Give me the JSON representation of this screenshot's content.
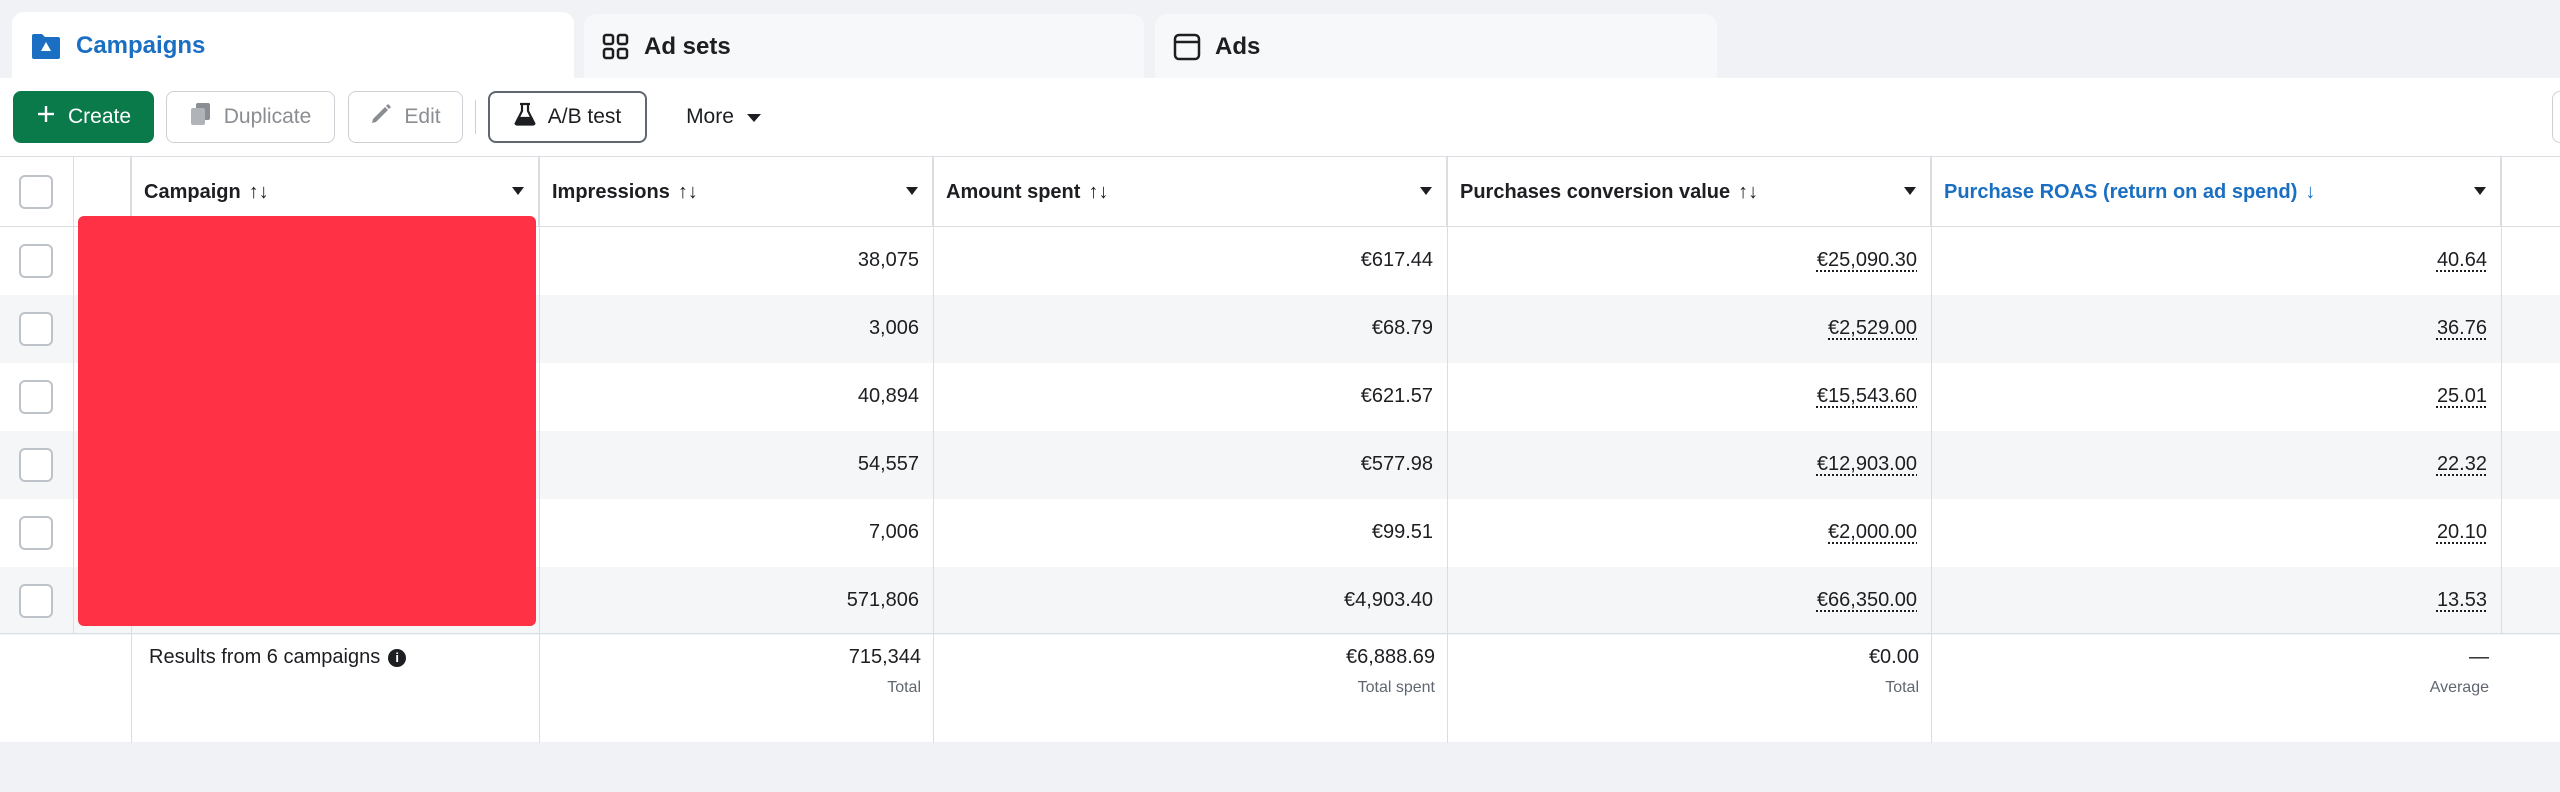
{
  "tabs": [
    {
      "label": "Campaigns",
      "icon": "folder-icon",
      "active": true
    },
    {
      "label": "Ad sets",
      "icon": "grid-icon",
      "active": false
    },
    {
      "label": "Ads",
      "icon": "window-icon",
      "active": false
    }
  ],
  "toolbar": {
    "create_label": "Create",
    "duplicate_label": "Duplicate",
    "edit_label": "Edit",
    "ab_label": "A/B test",
    "more_label": "More"
  },
  "columns": {
    "campaign": "Campaign",
    "impressions": "Impressions",
    "amount_spent": "Amount spent",
    "conv_value": "Purchases conversion value",
    "roas": "Purchase ROAS (return on ad spend)"
  },
  "rows": [
    {
      "impressions": "38,075",
      "amount_spent": "€617.44",
      "conv_value": "€25,090.30",
      "roas": "40.64"
    },
    {
      "impressions": "3,006",
      "amount_spent": "€68.79",
      "conv_value": "€2,529.00",
      "roas": "36.76"
    },
    {
      "impressions": "40,894",
      "amount_spent": "€621.57",
      "conv_value": "€15,543.60",
      "roas": "25.01"
    },
    {
      "impressions": "54,557",
      "amount_spent": "€577.98",
      "conv_value": "€12,903.00",
      "roas": "22.32"
    },
    {
      "impressions": "7,006",
      "amount_spent": "€99.51",
      "conv_value": "€2,000.00",
      "roas": "20.10"
    },
    {
      "impressions": "571,806",
      "amount_spent": "€4,903.40",
      "conv_value": "€66,350.00",
      "roas": "13.53"
    }
  ],
  "footer": {
    "results_label": "Results from 6 campaigns",
    "impressions_total": "715,344",
    "impressions_sub": "Total",
    "spent_total": "€6,888.69",
    "spent_sub": "Total spent",
    "conv_total": "€0.00",
    "conv_sub": "Total",
    "roas_total": "—",
    "roas_sub": "Average"
  },
  "colors": {
    "accent": "#1a6fc2",
    "create": "#0b7a4b",
    "redaction": "#fe3244"
  }
}
